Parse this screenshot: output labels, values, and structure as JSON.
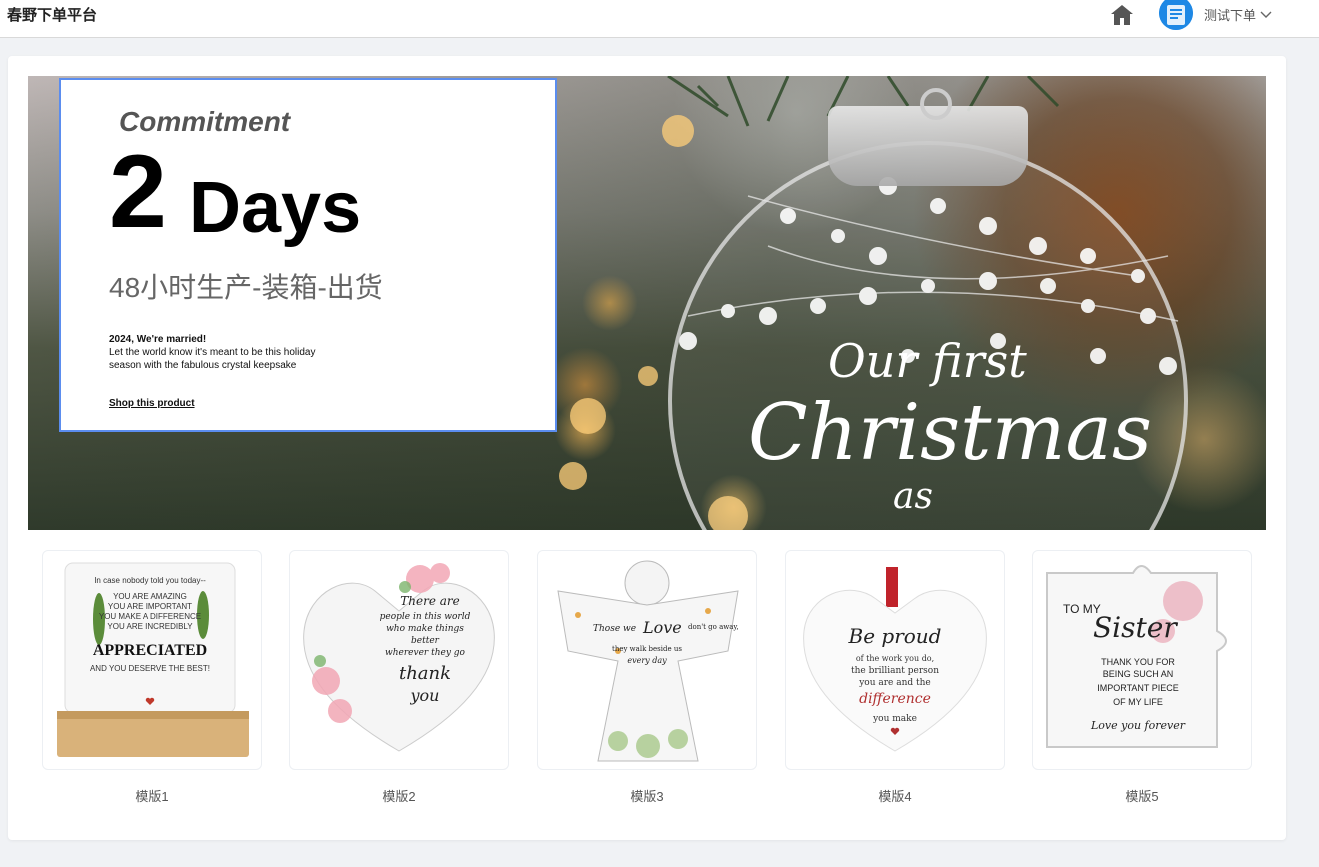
{
  "app": {
    "brand": "春野下单平台",
    "user_name": "测试下单"
  },
  "banner": {
    "commitment": "Commitment",
    "big_number": "2",
    "days_word": "Days",
    "subtitle_cn": "48小时生产-装箱-出货",
    "small_line1": "2024, We're married!",
    "small_line2": "Let the world know it's meant to be this holiday season with the fabulous crystal keepsake",
    "shop_link": "Shop this product",
    "ornament_line1": "Our first",
    "ornament_line2": "Christmas",
    "ornament_line3": "as"
  },
  "templates": [
    {
      "label": "模版1",
      "text1": "In case nobody told you today--",
      "text2": "YOU ARE AMAZING",
      "text3": "YOU ARE IMPORTANT",
      "text4": "YOU MAKE A DIFFERENCE",
      "text5": "YOU ARE INCREDIBLY",
      "text6": "APPRECIATED",
      "text7": "AND YOU DESERVE THE BEST!"
    },
    {
      "label": "模版2",
      "text1": "There are",
      "text2": "people in this world",
      "text3": "who make things",
      "text4": "better",
      "text5": "wherever they go",
      "text6": "thank",
      "text7": "you"
    },
    {
      "label": "模版3",
      "text1": "Those we",
      "text2": "Love",
      "text3": "don't go away,",
      "text4": "they walk beside us",
      "text5": "every day"
    },
    {
      "label": "模版4",
      "text1": "Be proud",
      "text2": "of the work you do,",
      "text3": "the brilliant person",
      "text4": "you are and the",
      "text5": "difference",
      "text6": "you make"
    },
    {
      "label": "模版5",
      "text1": "TO MY",
      "text2": "Sister",
      "text3": "THANK YOU FOR",
      "text4": "BEING SUCH AN",
      "text5": "IMPORTANT PIECE",
      "text6": "OF MY LIFE",
      "text7": "Love you forever"
    }
  ],
  "icons": {
    "home": "home-icon",
    "chevron": "chevron-down-icon"
  },
  "colors": {
    "accent": "#1e88e5",
    "overlay_border": "#5b8def"
  }
}
